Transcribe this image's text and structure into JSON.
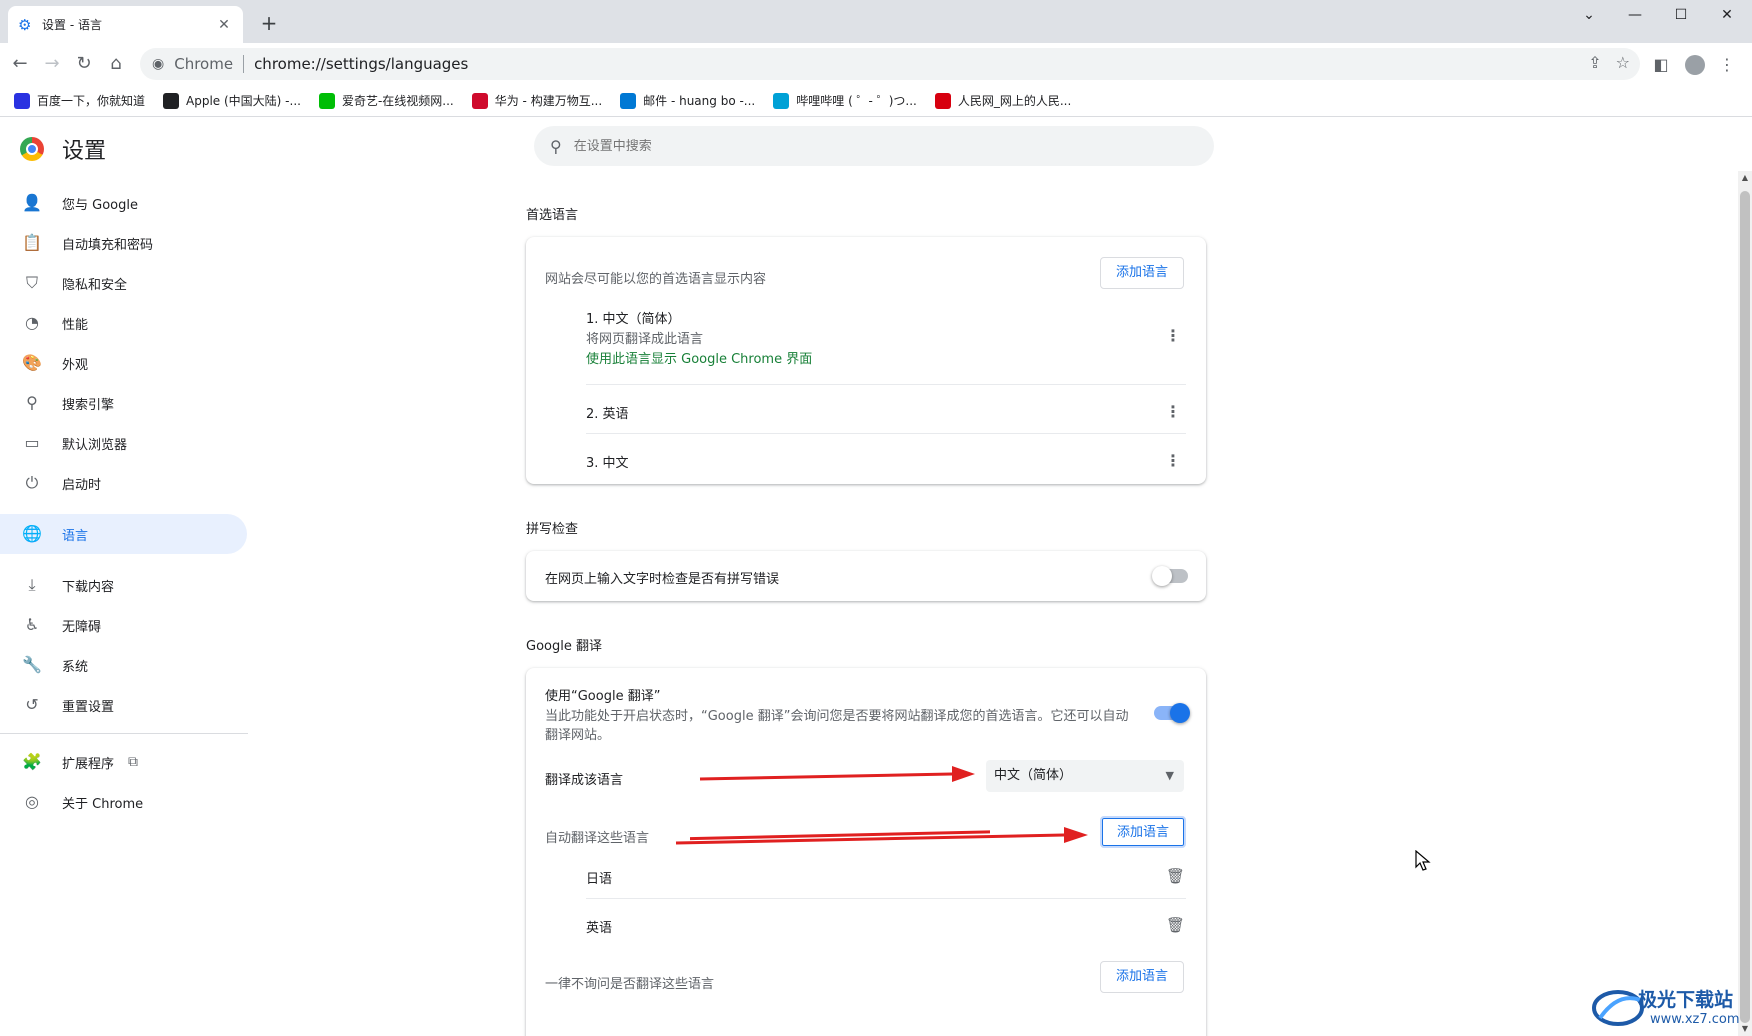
{
  "tab": {
    "title": "设置 - 语言",
    "close": "✕"
  },
  "toolbar": {
    "site_label": "Chrome",
    "url": "chrome://settings/languages"
  },
  "bookmarks": [
    {
      "label": "百度一下，你就知道",
      "color": "#2932e1"
    },
    {
      "label": "Apple (中国大陆) -...",
      "color": "#202124"
    },
    {
      "label": "爱奇艺-在线视频网...",
      "color": "#00be06"
    },
    {
      "label": "华为 - 构建万物互...",
      "color": "#cf0a2c"
    },
    {
      "label": "邮件 - huang bo -...",
      "color": "#0078d4"
    },
    {
      "label": "哔哩哔哩 ( ゜- ゜)つ...",
      "color": "#00a1d6"
    },
    {
      "label": "人民网_网上的人民...",
      "color": "#d7000f"
    }
  ],
  "settings": {
    "title": "设置",
    "search_placeholder": "在设置中搜索",
    "nav": [
      {
        "label": "您与 Google",
        "icon": "person-icon"
      },
      {
        "label": "自动填充和密码",
        "icon": "clipboard-icon"
      },
      {
        "label": "隐私和安全",
        "icon": "shield-icon"
      },
      {
        "label": "性能",
        "icon": "speedometer-icon"
      },
      {
        "label": "外观",
        "icon": "palette-icon"
      },
      {
        "label": "搜索引擎",
        "icon": "search-icon"
      },
      {
        "label": "默认浏览器",
        "icon": "browser-icon"
      },
      {
        "label": "启动时",
        "icon": "power-icon"
      },
      {
        "label": "语言",
        "icon": "globe-icon",
        "active": true
      },
      {
        "label": "下载内容",
        "icon": "download-icon"
      },
      {
        "label": "无障碍",
        "icon": "accessibility-icon"
      },
      {
        "label": "系统",
        "icon": "wrench-icon"
      },
      {
        "label": "重置设置",
        "icon": "reset-icon"
      }
    ],
    "nav_extra": [
      {
        "label": "扩展程序",
        "icon": "puzzle-icon"
      },
      {
        "label": "关于 Chrome",
        "icon": "chrome-icon"
      }
    ]
  },
  "preferred": {
    "section_title": "首选语言",
    "description": "网站会尽可能以您的首选语言显示内容",
    "add_button": "添加语言",
    "languages": [
      {
        "label": "1. 中文（简体）",
        "sub": "将网页翻译成此语言",
        "note": "使用此语言显示 Google Chrome 界面"
      },
      {
        "label": "2. 英语"
      },
      {
        "label": "3. 中文"
      }
    ]
  },
  "spellcheck": {
    "section_title": "拼写检查",
    "label": "在网页上输入文字时检查是否有拼写错误",
    "enabled": false
  },
  "translate": {
    "section_title": "Google 翻译",
    "use_title": "使用“Google 翻译”",
    "use_desc_1": "当此功能处于开启状态时，“Google 翻译”会询问您是否要将网站翻译成您的首选语言。它还可以自动",
    "use_desc_2": "翻译网站。",
    "enabled": true,
    "target_label": "翻译成该语言",
    "target_value": "中文（简体）",
    "auto_label": "自动翻译这些语言",
    "auto_add_button": "添加语言",
    "auto_languages": [
      "日语",
      "英语"
    ],
    "never_label": "一律不询问是否翻译这些语言",
    "never_add_button": "添加语言"
  },
  "watermark": {
    "brand": "极光下载站",
    "url": "www.xz7.com"
  },
  "colors": {
    "accent": "#1a73e8",
    "green": "#188038",
    "annotation_arrow": "#e02020"
  }
}
